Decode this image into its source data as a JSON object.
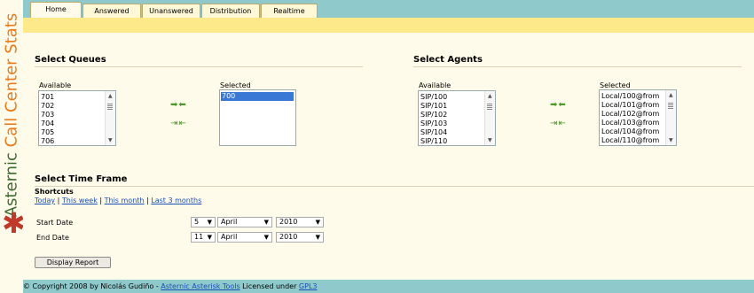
{
  "brand": {
    "part1": "Asternic ",
    "part2": "Call Center Stats"
  },
  "tabs": [
    {
      "label": "Home"
    },
    {
      "label": "Answered"
    },
    {
      "label": "Unanswered"
    },
    {
      "label": "Distribution"
    },
    {
      "label": "Realtime"
    }
  ],
  "queues": {
    "heading": "Select Queues",
    "available_label": "Available",
    "available": [
      "701",
      "702",
      "703",
      "704",
      "705",
      "706"
    ],
    "selected_label": "Selected",
    "selected": [
      "700"
    ]
  },
  "agents": {
    "heading": "Select Agents",
    "available_label": "Available",
    "available": [
      "SIP/100",
      "SIP/101",
      "SIP/102",
      "SIP/103",
      "SIP/104",
      "SIP/110"
    ],
    "selected_label": "Selected",
    "selected": [
      "Local/100@from",
      "Local/101@from",
      "Local/102@from",
      "Local/103@from",
      "Local/104@from",
      "Local/110@from"
    ]
  },
  "timeframe": {
    "heading": "Select Time Frame",
    "shortcuts_label": "Shortcuts",
    "shortcuts": [
      "Today",
      "This week",
      "This month",
      "Last 3 months"
    ],
    "start_label": "Start Date",
    "start": {
      "day": "5",
      "month": "April",
      "year": "2010"
    },
    "end_label": "End Date",
    "end": {
      "day": "11",
      "month": "April",
      "year": "2010"
    }
  },
  "display_button": "Display Report",
  "footer": {
    "prefix": "© Copyright 2008 by Nicolás Gudiño - ",
    "link1": "Asternic Asterisk Tools",
    "middle": " Licensed under ",
    "link2": "GPL3"
  }
}
